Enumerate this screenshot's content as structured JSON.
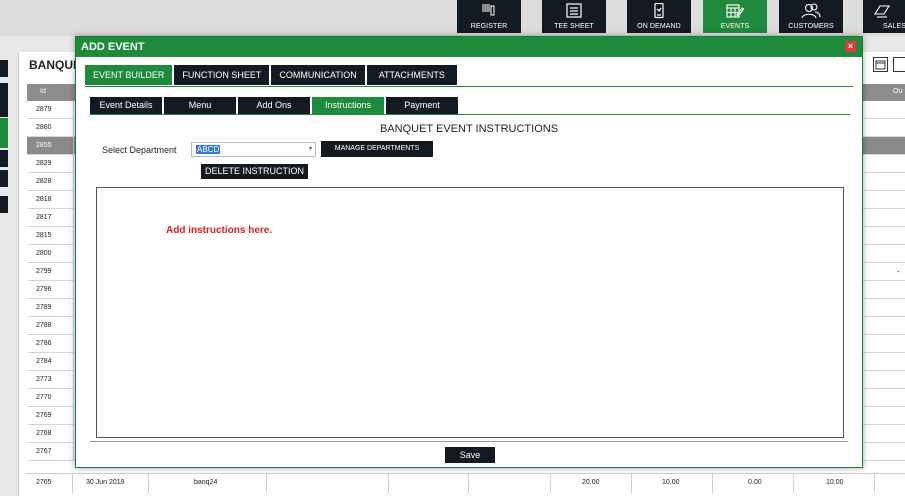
{
  "nav": {
    "items": [
      {
        "label": "REGISTER",
        "icon": "register-icon"
      },
      {
        "label": "TEE SHEET",
        "icon": "tee-sheet-icon"
      },
      {
        "label": "ON DEMAND",
        "icon": "mobile-icon"
      },
      {
        "label": "EVENTS",
        "icon": "events-icon",
        "active": true
      },
      {
        "label": "CUSTOMERS",
        "icon": "customers-icon"
      },
      {
        "label": "SALES",
        "icon": "sales-icon"
      }
    ],
    "active_color": "#1e8a3c"
  },
  "banquet": {
    "title": "BANQUE",
    "header": {
      "id": "Id",
      "right": "Ou"
    },
    "ids": [
      "2879",
      "2860",
      "2855",
      "2829",
      "2828",
      "2818",
      "2817",
      "2815",
      "2800",
      "2799",
      "2796",
      "2789",
      "2788",
      "2786",
      "2784",
      "2773",
      "2770",
      "2769",
      "2768",
      "2767"
    ],
    "selected_id": "2855",
    "row_2799_right": "-",
    "last_row": {
      "id": "2765",
      "date": "30 Jun 2019",
      "name": "banq24",
      "v1": "20.00",
      "v2": "10.00",
      "v3": "0.00",
      "v4": "10.00"
    }
  },
  "modal": {
    "title": "ADD EVENT",
    "close": "×",
    "tabs": [
      "EVENT BUILDER",
      "FUNCTION SHEET",
      "COMMUNICATION",
      "ATTACHMENTS"
    ],
    "active_tab": "EVENT BUILDER",
    "subtabs": [
      "Event Details",
      "Menu",
      "Add Ons",
      "Instructions",
      "Payment"
    ],
    "active_subtab": "Instructions",
    "section_title": "BANQUET EVENT INSTRUCTIONS",
    "department_label": "Select Department",
    "department_value": "ABCD",
    "manage_button": "MANAGE DEPARTMENTS",
    "delete_button": "DELETE INSTRUCTION",
    "editor_placeholder": "Add instructions here.",
    "save_button": "Save"
  }
}
